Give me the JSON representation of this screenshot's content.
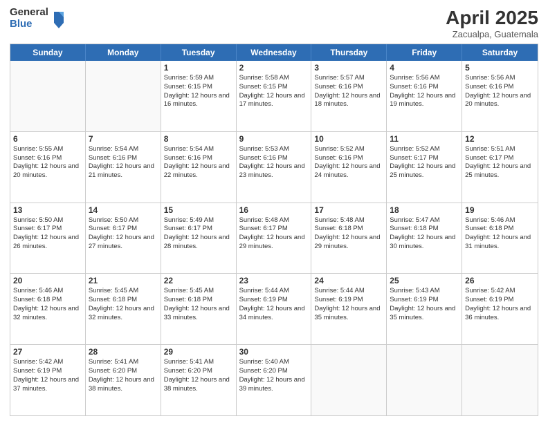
{
  "header": {
    "logo_general": "General",
    "logo_blue": "Blue",
    "month_title": "April 2025",
    "location": "Zacualpa, Guatemala"
  },
  "days_of_week": [
    "Sunday",
    "Monday",
    "Tuesday",
    "Wednesday",
    "Thursday",
    "Friday",
    "Saturday"
  ],
  "rows": [
    [
      {
        "day": "",
        "info": ""
      },
      {
        "day": "",
        "info": ""
      },
      {
        "day": "1",
        "info": "Sunrise: 5:59 AM\nSunset: 6:15 PM\nDaylight: 12 hours and 16 minutes."
      },
      {
        "day": "2",
        "info": "Sunrise: 5:58 AM\nSunset: 6:15 PM\nDaylight: 12 hours and 17 minutes."
      },
      {
        "day": "3",
        "info": "Sunrise: 5:57 AM\nSunset: 6:16 PM\nDaylight: 12 hours and 18 minutes."
      },
      {
        "day": "4",
        "info": "Sunrise: 5:56 AM\nSunset: 6:16 PM\nDaylight: 12 hours and 19 minutes."
      },
      {
        "day": "5",
        "info": "Sunrise: 5:56 AM\nSunset: 6:16 PM\nDaylight: 12 hours and 20 minutes."
      }
    ],
    [
      {
        "day": "6",
        "info": "Sunrise: 5:55 AM\nSunset: 6:16 PM\nDaylight: 12 hours and 20 minutes."
      },
      {
        "day": "7",
        "info": "Sunrise: 5:54 AM\nSunset: 6:16 PM\nDaylight: 12 hours and 21 minutes."
      },
      {
        "day": "8",
        "info": "Sunrise: 5:54 AM\nSunset: 6:16 PM\nDaylight: 12 hours and 22 minutes."
      },
      {
        "day": "9",
        "info": "Sunrise: 5:53 AM\nSunset: 6:16 PM\nDaylight: 12 hours and 23 minutes."
      },
      {
        "day": "10",
        "info": "Sunrise: 5:52 AM\nSunset: 6:16 PM\nDaylight: 12 hours and 24 minutes."
      },
      {
        "day": "11",
        "info": "Sunrise: 5:52 AM\nSunset: 6:17 PM\nDaylight: 12 hours and 25 minutes."
      },
      {
        "day": "12",
        "info": "Sunrise: 5:51 AM\nSunset: 6:17 PM\nDaylight: 12 hours and 25 minutes."
      }
    ],
    [
      {
        "day": "13",
        "info": "Sunrise: 5:50 AM\nSunset: 6:17 PM\nDaylight: 12 hours and 26 minutes."
      },
      {
        "day": "14",
        "info": "Sunrise: 5:50 AM\nSunset: 6:17 PM\nDaylight: 12 hours and 27 minutes."
      },
      {
        "day": "15",
        "info": "Sunrise: 5:49 AM\nSunset: 6:17 PM\nDaylight: 12 hours and 28 minutes."
      },
      {
        "day": "16",
        "info": "Sunrise: 5:48 AM\nSunset: 6:17 PM\nDaylight: 12 hours and 29 minutes."
      },
      {
        "day": "17",
        "info": "Sunrise: 5:48 AM\nSunset: 6:18 PM\nDaylight: 12 hours and 29 minutes."
      },
      {
        "day": "18",
        "info": "Sunrise: 5:47 AM\nSunset: 6:18 PM\nDaylight: 12 hours and 30 minutes."
      },
      {
        "day": "19",
        "info": "Sunrise: 5:46 AM\nSunset: 6:18 PM\nDaylight: 12 hours and 31 minutes."
      }
    ],
    [
      {
        "day": "20",
        "info": "Sunrise: 5:46 AM\nSunset: 6:18 PM\nDaylight: 12 hours and 32 minutes."
      },
      {
        "day": "21",
        "info": "Sunrise: 5:45 AM\nSunset: 6:18 PM\nDaylight: 12 hours and 32 minutes."
      },
      {
        "day": "22",
        "info": "Sunrise: 5:45 AM\nSunset: 6:18 PM\nDaylight: 12 hours and 33 minutes."
      },
      {
        "day": "23",
        "info": "Sunrise: 5:44 AM\nSunset: 6:19 PM\nDaylight: 12 hours and 34 minutes."
      },
      {
        "day": "24",
        "info": "Sunrise: 5:44 AM\nSunset: 6:19 PM\nDaylight: 12 hours and 35 minutes."
      },
      {
        "day": "25",
        "info": "Sunrise: 5:43 AM\nSunset: 6:19 PM\nDaylight: 12 hours and 35 minutes."
      },
      {
        "day": "26",
        "info": "Sunrise: 5:42 AM\nSunset: 6:19 PM\nDaylight: 12 hours and 36 minutes."
      }
    ],
    [
      {
        "day": "27",
        "info": "Sunrise: 5:42 AM\nSunset: 6:19 PM\nDaylight: 12 hours and 37 minutes."
      },
      {
        "day": "28",
        "info": "Sunrise: 5:41 AM\nSunset: 6:20 PM\nDaylight: 12 hours and 38 minutes."
      },
      {
        "day": "29",
        "info": "Sunrise: 5:41 AM\nSunset: 6:20 PM\nDaylight: 12 hours and 38 minutes."
      },
      {
        "day": "30",
        "info": "Sunrise: 5:40 AM\nSunset: 6:20 PM\nDaylight: 12 hours and 39 minutes."
      },
      {
        "day": "",
        "info": ""
      },
      {
        "day": "",
        "info": ""
      },
      {
        "day": "",
        "info": ""
      }
    ]
  ]
}
